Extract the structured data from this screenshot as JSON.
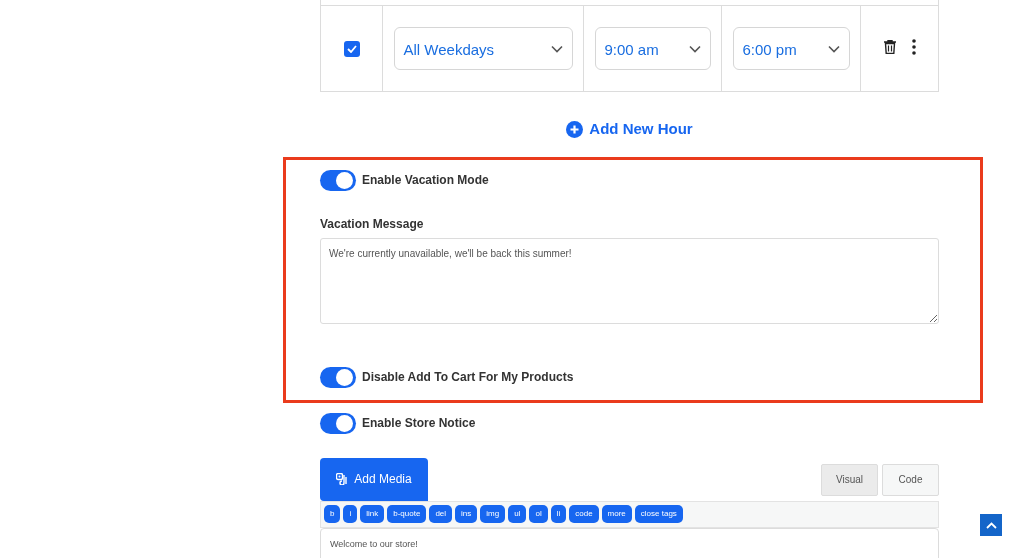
{
  "hours_table": {
    "rows": [
      {
        "checked": true,
        "day": "All Weekdays",
        "open": "9:00 am",
        "close": "6:00 pm"
      }
    ]
  },
  "add_hour_link": "Add New Hour",
  "highlighted_section": {
    "vacation_toggle": {
      "label": "Enable Vacation Mode",
      "on": true
    },
    "message_label": "Vacation Message",
    "message_value": "We're currently unavailable, we'll be back this summer!",
    "cart_toggle": {
      "label": "Disable Add To Cart For My Products",
      "on": true
    }
  },
  "store_notice_toggle": {
    "label": "Enable Store Notice",
    "on": true
  },
  "editor": {
    "add_media": "Add Media",
    "tabs": [
      {
        "label": "Visual",
        "selected": false
      },
      {
        "label": "Code",
        "selected": true
      }
    ],
    "quicktags": [
      "b",
      "i",
      "link",
      "b-quote",
      "del",
      "ins",
      "img",
      "ul",
      "ol",
      "li",
      "code",
      "more",
      "close tags"
    ],
    "content": "Welcome to our store!"
  }
}
